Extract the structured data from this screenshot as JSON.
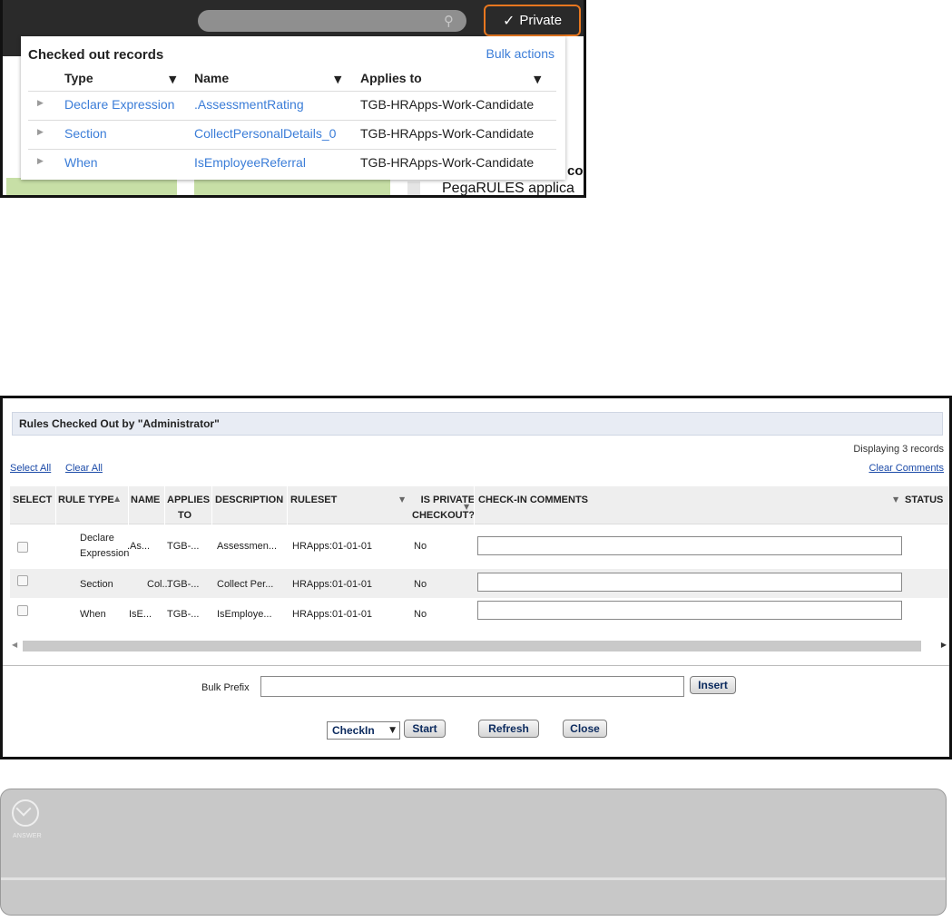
{
  "top": {
    "private_label": "Private",
    "records_title": "Checked out records",
    "bulk_actions": "Bulk actions",
    "columns": {
      "type": "Type",
      "name": "Name",
      "applies_to": "Applies to"
    },
    "rows": [
      {
        "type": "Declare Expression",
        "name": ".AssessmentRating",
        "applies_to": "TGB-HRApps-Work-Candidate"
      },
      {
        "type": "Section",
        "name": "CollectPersonalDetails_0",
        "applies_to": "TGB-HRApps-Work-Candidate"
      },
      {
        "type": "When",
        "name": "IsEmployeeReferral",
        "applies_to": "TGB-HRApps-Work-Candidate"
      }
    ],
    "background": {
      "text_co": "co",
      "text_pega": "PegaRULES applica"
    }
  },
  "dialog": {
    "title": "Rules Checked Out by \"Administrator\"",
    "displaying": "Displaying 3 records",
    "select_all": "Select All",
    "clear_all": "Clear All",
    "clear_comments": "Clear Comments",
    "columns": {
      "select": "SELECT",
      "rule_type": "RULE TYPE",
      "name": "NAME",
      "applies_to_1": "APPLIES",
      "applies_to_2": "TO",
      "description": "DESCRIPTION",
      "ruleset": "RULESET",
      "private_1": "IS PRIVATE",
      "private_2": "CHECKOUT?",
      "comments": "CHECK-IN COMMENTS",
      "status": "STATUS"
    },
    "rows": [
      {
        "rule_type_1": "Declare",
        "rule_type_2": "Expression",
        "name": ".As...",
        "applies_to": "TGB-...",
        "description": "Assessmen...",
        "ruleset": "HRApps:01-01-01",
        "private": "No",
        "comment": ""
      },
      {
        "rule_type_1": "Section",
        "rule_type_2": "",
        "name": "Col...",
        "applies_to": "TGB-...",
        "description": "Collect Per...",
        "ruleset": "HRApps:01-01-01",
        "private": "No",
        "comment": ""
      },
      {
        "rule_type_1": "When",
        "rule_type_2": "",
        "name": "IsE...",
        "applies_to": "TGB-...",
        "description": "IsEmploye...",
        "ruleset": "HRApps:01-01-01",
        "private": "No",
        "comment": ""
      }
    ],
    "bulk_prefix_label": "Bulk Prefix",
    "bulk_prefix_value": "",
    "insert_label": "Insert",
    "action_select": "CheckIn",
    "start_label": "Start",
    "refresh_label": "Refresh",
    "close_label": "Close"
  },
  "answer": {
    "label": "ANSWER"
  }
}
